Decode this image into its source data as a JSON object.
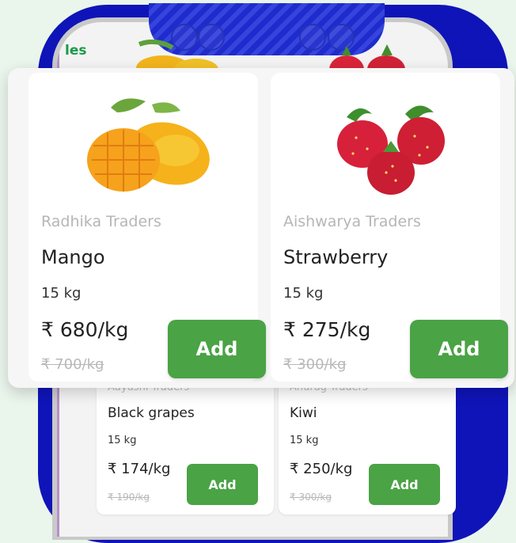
{
  "section_tag": "les",
  "featured": [
    {
      "seller": "Radhika Traders",
      "name": "Mango",
      "qty": "15 kg",
      "price": "₹ 680/kg",
      "old_price": "₹ 700/kg",
      "add_label": "Add",
      "image_icon": "mango-image"
    },
    {
      "seller": "Aishwarya Traders",
      "name": "Strawberry",
      "qty": "15 kg",
      "price": "₹ 275/kg",
      "old_price": "₹ 300/kg",
      "add_label": "Add",
      "image_icon": "strawberry-image"
    }
  ],
  "list": [
    {
      "seller": "Aayushi Traders",
      "name": "Black grapes",
      "qty": "15 kg",
      "price": "₹ 174/kg",
      "old_price": "₹ 190/kg",
      "add_label": "Add"
    },
    {
      "seller": "Anurag Traders",
      "name": "Kiwi",
      "qty": "15 kg",
      "price": "₹ 250/kg",
      "old_price": "₹ 300/kg",
      "add_label": "Add"
    }
  ],
  "colors": {
    "accent": "#4aa345",
    "frame": "#0f14b8",
    "section_tag": "#1a9a49",
    "background": "#eaf5ec"
  }
}
